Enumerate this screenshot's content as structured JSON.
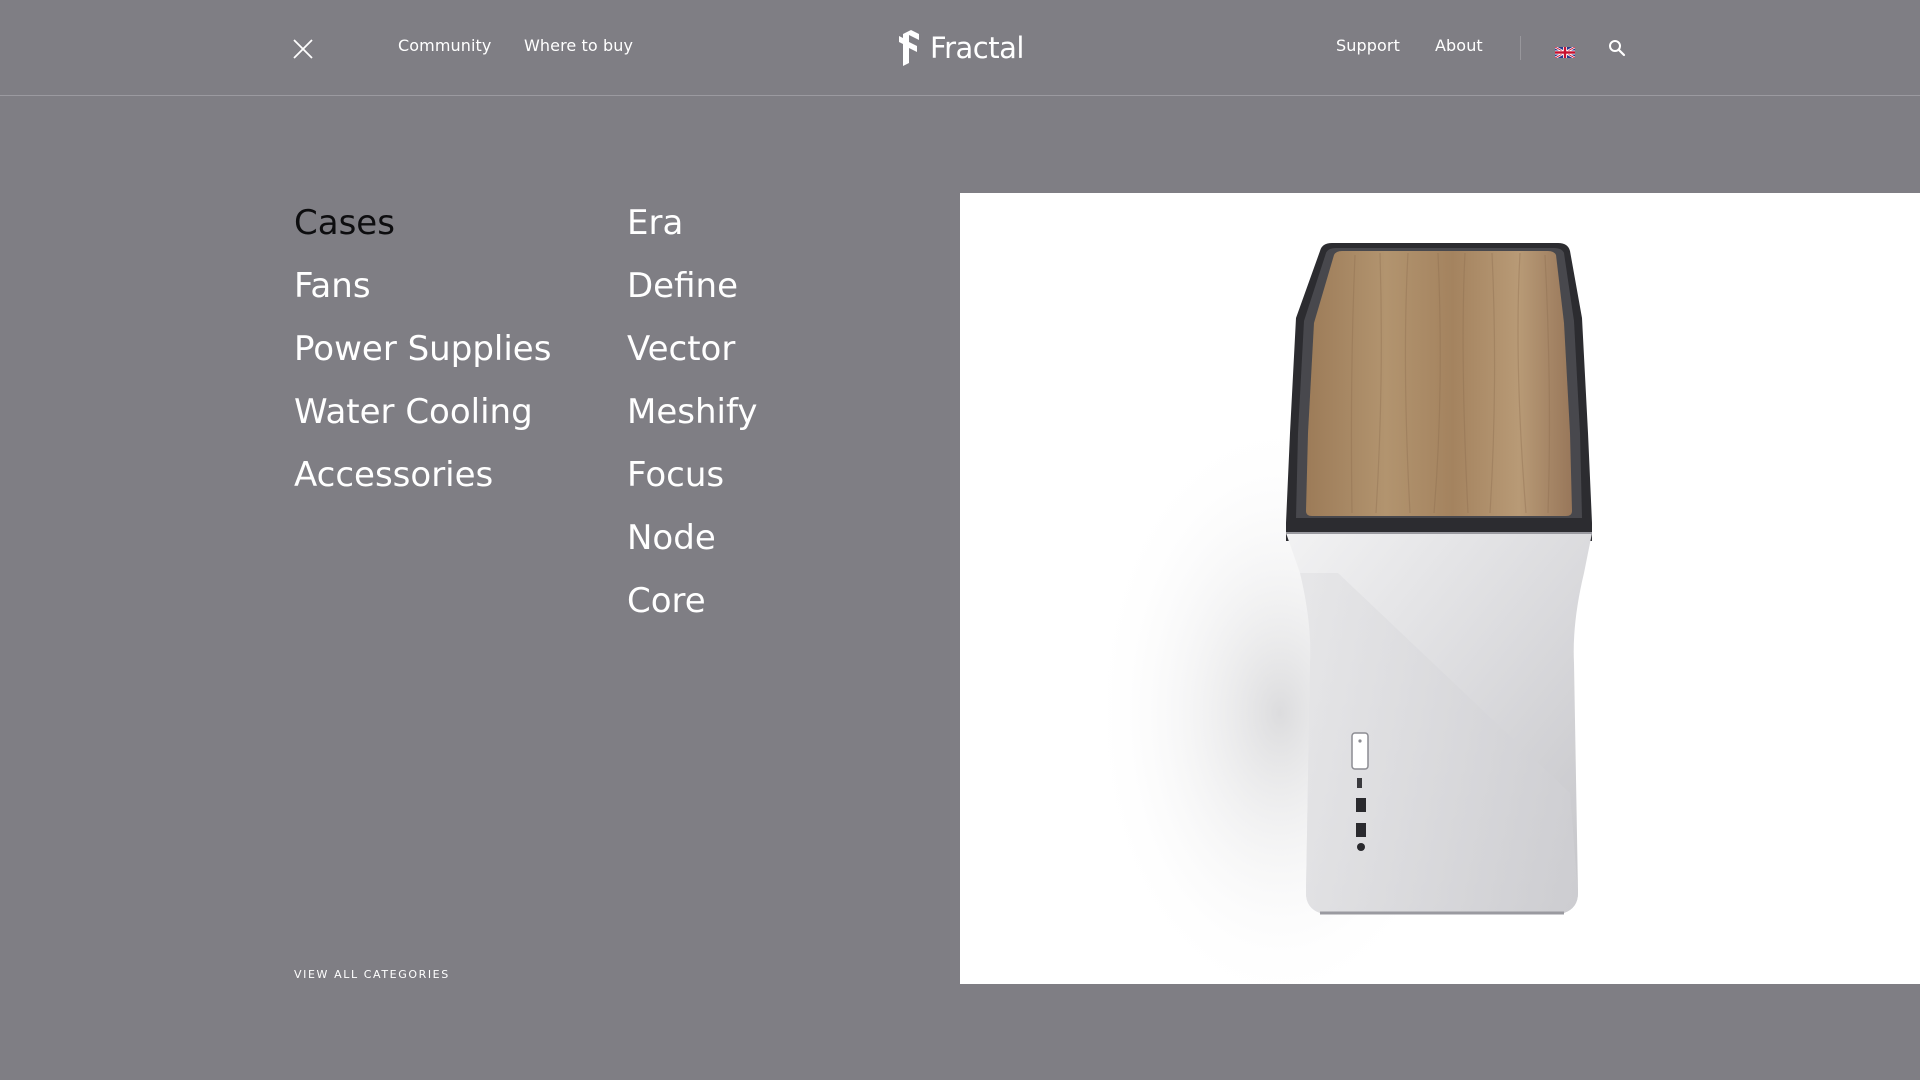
{
  "header": {
    "nav_left": [
      "Community",
      "Where to buy"
    ],
    "logo_text": "Fractal",
    "nav_right": [
      "Support",
      "About"
    ]
  },
  "menu": {
    "categories": [
      "Cases",
      "Fans",
      "Power Supplies",
      "Water Cooling",
      "Accessories"
    ],
    "active_category": "Cases",
    "series": [
      "Era",
      "Define",
      "Vector",
      "Meshify",
      "Focus",
      "Node",
      "Core"
    ],
    "view_all_label": "VIEW ALL CATEGORIES"
  },
  "icons": {
    "close": "close-icon",
    "logo": "fractal-logo-icon",
    "language": "uk-flag-icon",
    "search": "search-icon"
  },
  "colors": {
    "background": "#7f7e84",
    "text": "#ffffff",
    "active_text": "#0d0d0f",
    "panel": "#ffffff",
    "wood": "#a88a68"
  }
}
